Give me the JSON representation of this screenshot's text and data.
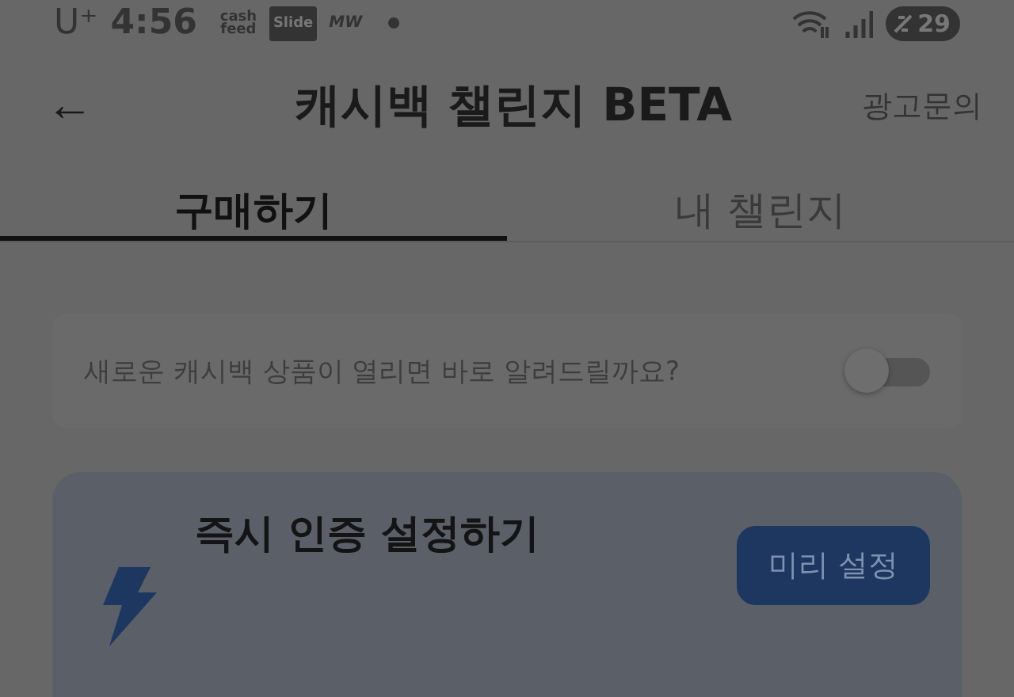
{
  "status_bar": {
    "carrier": "U⁺",
    "time": "4:56",
    "apps": [
      {
        "kind": "stacked",
        "label": "cash feed"
      },
      {
        "kind": "boxed",
        "label": "Slide"
      },
      {
        "kind": "plain",
        "label": "MW"
      }
    ],
    "battery": "29"
  },
  "header": {
    "back": "←",
    "title": "캐시백 챌린지 BETA",
    "action": "광고문의"
  },
  "tabs": [
    {
      "label": "구매하기",
      "selected": true
    },
    {
      "label": "내 챌린지",
      "selected": false
    }
  ],
  "notify": {
    "text": "새로운 캐시백 상품이 열리면 바로 알려드릴까요?",
    "on": false
  },
  "promo": {
    "title": "즉시 인증 설정하기",
    "button": "미리 설정"
  }
}
